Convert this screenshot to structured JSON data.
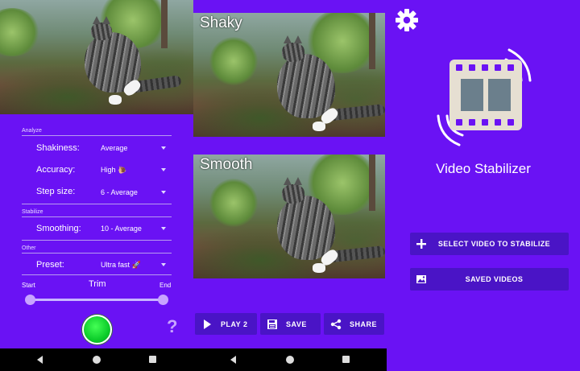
{
  "panel1": {
    "sections": {
      "analyze": "Analyze",
      "stabilize": "Stabilize",
      "other": "Other"
    },
    "rows": {
      "shakiness": {
        "label": "Shakiness:",
        "value": "Average"
      },
      "accuracy": {
        "label": "Accuracy:",
        "value": "High 🐌"
      },
      "step_size": {
        "label": "Step size:",
        "value": "6 - Average"
      },
      "smoothing": {
        "label": "Smoothing:",
        "value": "10 - Average"
      },
      "preset": {
        "label": "Preset:",
        "value": "Ultra fast 🚀"
      }
    },
    "trim": {
      "start": "Start",
      "title": "Trim",
      "end": "End",
      "start_fraction": 0.0,
      "end_fraction": 1.0
    },
    "help": "?"
  },
  "panel2": {
    "shaky_label": "Shaky",
    "smooth_label": "Smooth",
    "buttons": {
      "play": "PLAY 2",
      "save": "SAVE",
      "share": "SHARE"
    }
  },
  "panel3": {
    "app_title": "Video Stabilizer",
    "select_button": "SELECT VIDEO TO STABILIZE",
    "saved_button": "SAVED VIDEOS"
  },
  "colors": {
    "background": "#6a12f4",
    "button": "#4a14c6",
    "accent": "#c8a4ff",
    "go_button": "#0ccc2a"
  },
  "icons": {
    "settings": "gear-icon",
    "logo": "video-stabilizer-logo",
    "add": "plus-icon",
    "gallery": "image-icon",
    "play": "play-icon",
    "save": "save-icon",
    "share": "share-icon"
  }
}
